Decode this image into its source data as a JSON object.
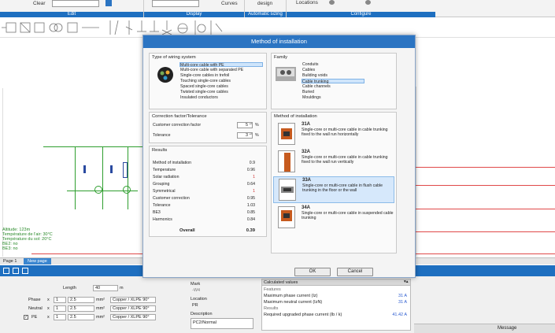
{
  "ribbon": {
    "clear_label": "Clear",
    "curves_label": "Curves",
    "design_label": "design",
    "locations_label": "Locations",
    "groups": [
      "Edit",
      "Display",
      "Automatic sizing",
      "Configure"
    ]
  },
  "schematic": {
    "altitude": "Altitude: 123m",
    "temp_air": "Température de l'air: 30°C",
    "temp_soil": "Température du sol: 20°C",
    "be2": "BE2: no",
    "be3": "BE3: no"
  },
  "page_tabs": {
    "page1": "Page 1",
    "new_page": "New page"
  },
  "dialog": {
    "title": "Method of installation",
    "wiring": {
      "title": "Type of wiring system",
      "items": [
        "Multi-core cable with PE",
        "Multi-core cable with separated PE",
        "Single-core cables in trefoil",
        "Touching single-core cables",
        "Spaced single-core cables",
        "Twisted single-core cables",
        "Insulated conductors"
      ],
      "selected": 0
    },
    "family": {
      "title": "Family",
      "items": [
        "Conduits",
        "Cables",
        "Building voids",
        "Cable trunking",
        "Cable channels",
        "Buried",
        "Mouldings"
      ],
      "selected": 3
    },
    "temperature": {
      "title": "Temperature correction factor",
      "ambient_label": "Ambient temperature",
      "ambient_value": "35",
      "unit": "°C"
    },
    "grouping": {
      "title": "Grouping",
      "symmetrical_label": "Symmetrical arrangement",
      "circuits_label": "Number of circuits per layer",
      "circuits_sub": "(including the cable being calculated)",
      "circuits_value": "2",
      "layers_label": "Number of layers",
      "layers_value": "2"
    },
    "correction": {
      "title": "Correction factor/Tolerance",
      "customer_label": "Customer correction factor",
      "customer_value": "5",
      "customer_unit": "%",
      "tolerance_label": "Tolerance",
      "tolerance_value": "3",
      "tolerance_unit": "%"
    },
    "results": {
      "title": "Results",
      "rows": [
        {
          "label": "Method of installation",
          "value": "0.9"
        },
        {
          "label": "Temperature",
          "value": "0.96"
        },
        {
          "label": "Solar radiation",
          "value": "1"
        },
        {
          "label": "Grouping",
          "value": "0.64"
        },
        {
          "label": "Symmetrical",
          "value": "1"
        },
        {
          "label": "Customer correction",
          "value": "0.95"
        },
        {
          "label": "Tolerance",
          "value": "1.03"
        },
        {
          "label": "BE3",
          "value": "0.85"
        },
        {
          "label": "Harmonics",
          "value": "0.84"
        }
      ],
      "overall_label": "Overall",
      "overall_value": "0.39"
    },
    "methods": {
      "title": "Method of installation",
      "items": [
        {
          "code": "31A",
          "desc": "Single-core or multi-core cable in cable trunking fixed to the wall run horizontally"
        },
        {
          "code": "32A",
          "desc": "Single-core or multi-core cable in cable trunking fixed to the wall run vertically"
        },
        {
          "code": "33A",
          "desc": "Single-core or multi-core cable in flush cable trunking in the floor or the wall"
        },
        {
          "code": "34A",
          "desc": "Single-core or multi-core cable in suspended cable trunking"
        }
      ],
      "selected": 2
    },
    "ok_label": "OK",
    "cancel_label": "Cancel"
  },
  "bottom": {
    "length_label": "Length",
    "length_value": "40",
    "length_unit": "m",
    "phase_label": "Phase",
    "neutral_label": "Neutral",
    "pe_label": "PE",
    "x_symbol": "x",
    "multiplier": "1",
    "section": "2.5",
    "unit_mm2": "mm²",
    "material": "Copper / XLPE 90°",
    "mark_label": "Mark",
    "mark_value": "-W4",
    "location_label": "Location",
    "location_value": "PR",
    "description_label": "Description",
    "description_value": "PC2/Normal",
    "calc_title": "Calculated values",
    "features_label": "Features",
    "max_phase_label": "Maximum phase current (Iz)",
    "max_phase_value": "31 A",
    "max_neutral_label": "Maximum neutral current (IzN)",
    "max_neutral_value": "31 A",
    "results_label": "Results",
    "upgraded_label": "Required upgraded phase current (Ib / k)",
    "upgraded_value": "41.42 A",
    "message_label": "Message"
  }
}
